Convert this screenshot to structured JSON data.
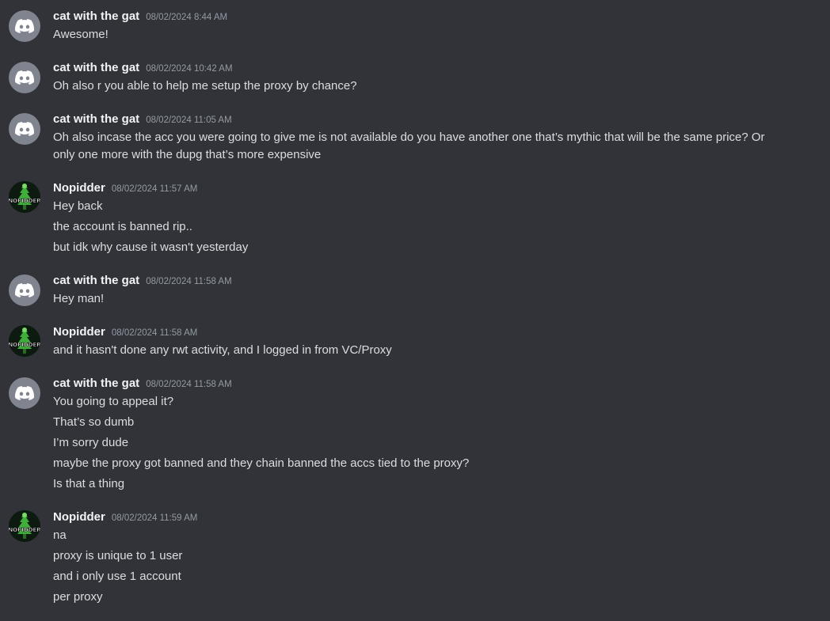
{
  "messages": [
    {
      "author": "cat with the gat",
      "avatar_icon": "discord-icon",
      "timestamp": "08/02/2024 8:44 AM",
      "lines": [
        "Awesome!"
      ]
    },
    {
      "author": "cat with the gat",
      "avatar_icon": "discord-icon",
      "timestamp": "08/02/2024 10:42 AM",
      "lines": [
        "Oh also r you able to help me setup the proxy by chance?"
      ]
    },
    {
      "author": "cat with the gat",
      "avatar_icon": "discord-icon",
      "timestamp": "08/02/2024 11:05 AM",
      "lines": [
        "Oh also incase the acc you were going to give me is not available do you have another one that’s mythic that will be the same price? Or only one more with the dupg that’s more expensive"
      ]
    },
    {
      "author": "Nopidder",
      "avatar_icon": "nopidder-avatar",
      "avatar_text": "NOPIDDER",
      "timestamp": "08/02/2024 11:57 AM",
      "lines": [
        "Hey back",
        "the account is banned rip..",
        "but idk why cause it wasn't yesterday"
      ]
    },
    {
      "author": "cat with the gat",
      "avatar_icon": "discord-icon",
      "timestamp": "08/02/2024 11:58 AM",
      "lines": [
        "Hey man!"
      ]
    },
    {
      "author": "Nopidder",
      "avatar_icon": "nopidder-avatar",
      "avatar_text": "NOPIDDER",
      "timestamp": "08/02/2024 11:58 AM",
      "lines": [
        "and it hasn't done any rwt activity, and I logged in from VC/Proxy"
      ]
    },
    {
      "author": "cat with the gat",
      "avatar_icon": "discord-icon",
      "timestamp": "08/02/2024 11:58 AM",
      "lines": [
        "You going to appeal it?",
        "That’s so dumb",
        "I’m sorry dude",
        "maybe the proxy got banned and they chain banned the accs tied to the proxy?",
        "Is that a thing"
      ]
    },
    {
      "author": "Nopidder",
      "avatar_icon": "nopidder-avatar",
      "avatar_text": "NOPIDDER",
      "timestamp": "08/02/2024 11:59 AM",
      "lines": [
        "na",
        "proxy is unique to 1 user",
        "and i only use 1 account",
        "per proxy"
      ]
    }
  ],
  "colors": {
    "background": "#313338",
    "username": "#f2f3f5",
    "timestamp": "#949ba4",
    "text": "#dbdee1",
    "discord_avatar_bg": "#80848e",
    "nopidder_green": "#3fae3a"
  }
}
